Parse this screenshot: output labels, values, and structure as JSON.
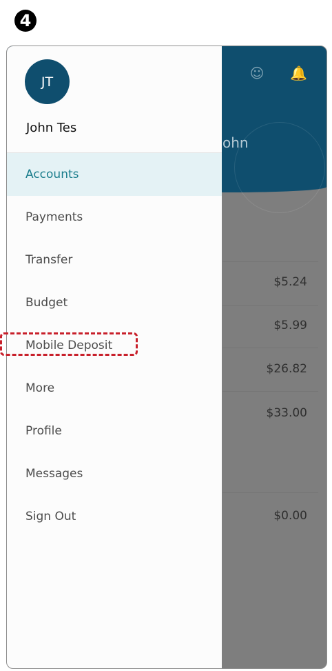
{
  "step_badge": "4",
  "drawer": {
    "avatar_initials": "JT",
    "user_name": "John Tes",
    "menu": [
      {
        "label": "Accounts",
        "active": true
      },
      {
        "label": "Payments"
      },
      {
        "label": "Transfer"
      },
      {
        "label": "Budget"
      },
      {
        "label": "Mobile Deposit",
        "highlighted": true
      },
      {
        "label": "More"
      },
      {
        "label": "Profile"
      },
      {
        "label": "Messages"
      },
      {
        "label": "Sign Out"
      }
    ]
  },
  "background": {
    "greeting_fragment": "ohn",
    "icons": [
      "smiley-icon",
      "bell-icon"
    ],
    "amounts": [
      "$5.24",
      "$5.99",
      "$26.82",
      "$33.00",
      "$0.00"
    ]
  },
  "colors": {
    "brand": "#0f4e6e",
    "active_item_bg": "#e4f2f5",
    "active_item_text": "#1a7d8c",
    "highlight": "#c8202b"
  }
}
